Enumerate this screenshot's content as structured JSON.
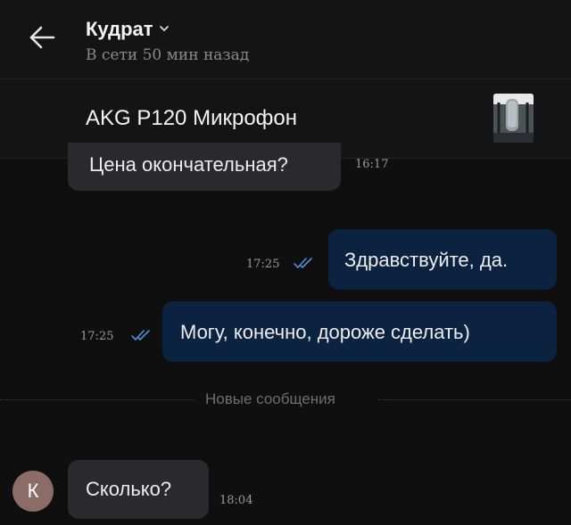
{
  "header": {
    "contact_name": "Кудрат",
    "status": "В сети 50 мин назад",
    "icons": {
      "back": "back-arrow-icon",
      "dropdown": "chevron-down-icon"
    }
  },
  "listing": {
    "title": "AKG P120 Микрофон",
    "thumbnail": "microphone-photo"
  },
  "messages": [
    {
      "direction": "incoming",
      "text": "Цена окончательная?",
      "time": "16:17"
    },
    {
      "direction": "outgoing",
      "text": "Здравствуйте, да.",
      "time": "17:25",
      "read": true
    },
    {
      "direction": "outgoing",
      "text": "Могу, конечно, дороже сделать)",
      "time": "17:25",
      "read": true
    },
    {
      "direction": "incoming",
      "text": "Сколько?",
      "time": "18:04",
      "avatar_letter": "К"
    }
  ],
  "divider": {
    "label": "Новые сообщения"
  },
  "colors": {
    "background": "#0f0f0f",
    "incoming_bubble": "#2a2a2c",
    "outgoing_bubble": "#0b2340",
    "read_ticks": "#4f8fd6",
    "avatar": "#8c6c66"
  }
}
